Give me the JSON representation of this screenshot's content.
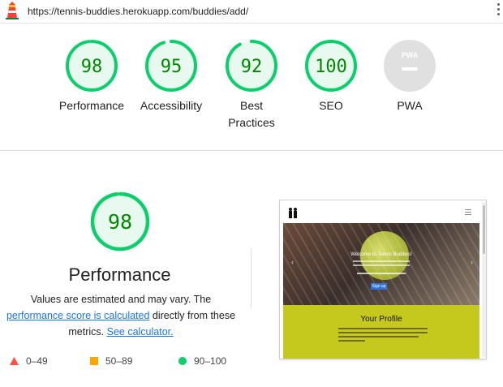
{
  "browser": {
    "url": "https://tennis-buddies.herokuapp.com/buddies/add/"
  },
  "colors": {
    "pass": "#0cce6b",
    "pass_bg": "#e8faef",
    "pass_text": "#008800",
    "average": "#ffa400",
    "fail": "#ff4e42",
    "na": "#e0e0e0",
    "link": "#1a73e8"
  },
  "categories": [
    {
      "score": "98",
      "label": "Performance",
      "value": 0.98
    },
    {
      "score": "95",
      "label": "Accessibility",
      "value": 0.95
    },
    {
      "score": "92",
      "label": "Best Practices",
      "value": 0.92
    },
    {
      "score": "100",
      "label": "SEO",
      "value": 1.0
    },
    {
      "score": "",
      "label": "PWA",
      "badge": "PWA"
    }
  ],
  "performance": {
    "score": "98",
    "value": 0.98,
    "title": "Performance",
    "desc_1": "Values are estimated and may vary. The",
    "desc_link_1": "performance score is calculated",
    "desc_2": " directly from these metrics.",
    "desc_link_2": "See calculator."
  },
  "legend": [
    {
      "range": "0–49",
      "icon": "fail-triangle-icon"
    },
    {
      "range": "50–89",
      "icon": "average-square-icon"
    },
    {
      "range": "90–100",
      "icon": "pass-circle-icon"
    }
  ],
  "screenshot": {
    "hero_title": "Welcome to Tennis Buddies!",
    "hero_button": "Sign up",
    "section_title": "Your Profile"
  }
}
